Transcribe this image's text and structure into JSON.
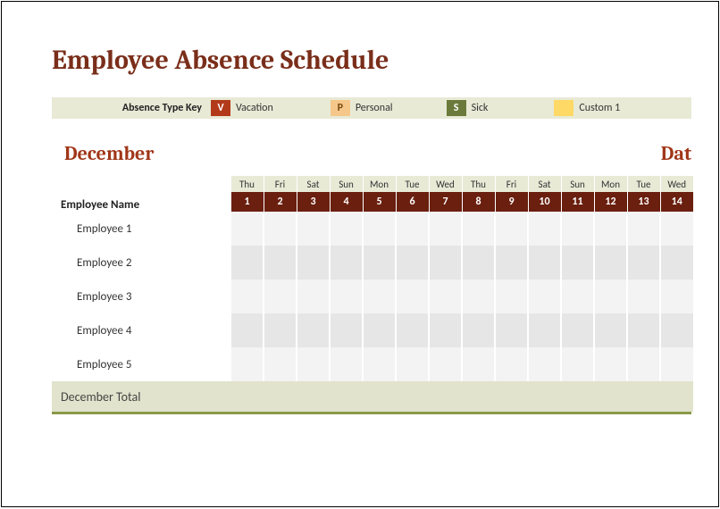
{
  "title": "Employee Absence Schedule",
  "key": {
    "label": "Absence Type Key",
    "items": [
      {
        "code": "V",
        "text": "Vacation",
        "chipClass": "chip-v"
      },
      {
        "code": "P",
        "text": "Personal",
        "chipClass": "chip-p"
      },
      {
        "code": "S",
        "text": "Sick",
        "chipClass": "chip-s"
      },
      {
        "code": "",
        "text": "Custom 1",
        "chipClass": "chip-c"
      }
    ]
  },
  "month": {
    "name": "December",
    "datesLabel": "Dat",
    "days": [
      {
        "dow": "Thu",
        "num": "1"
      },
      {
        "dow": "Fri",
        "num": "2"
      },
      {
        "dow": "Sat",
        "num": "3"
      },
      {
        "dow": "Sun",
        "num": "4"
      },
      {
        "dow": "Mon",
        "num": "5"
      },
      {
        "dow": "Tue",
        "num": "6"
      },
      {
        "dow": "Wed",
        "num": "7"
      },
      {
        "dow": "Thu",
        "num": "8"
      },
      {
        "dow": "Fri",
        "num": "9"
      },
      {
        "dow": "Sat",
        "num": "10"
      },
      {
        "dow": "Sun",
        "num": "11"
      },
      {
        "dow": "Mon",
        "num": "12"
      },
      {
        "dow": "Tue",
        "num": "13"
      },
      {
        "dow": "Wed",
        "num": "14"
      }
    ]
  },
  "headers": {
    "employeeName": "Employee Name"
  },
  "employees": [
    {
      "name": "Employee 1"
    },
    {
      "name": "Employee 2"
    },
    {
      "name": "Employee 3"
    },
    {
      "name": "Employee 4"
    },
    {
      "name": "Employee 5"
    }
  ],
  "totalLabel": "December Total"
}
